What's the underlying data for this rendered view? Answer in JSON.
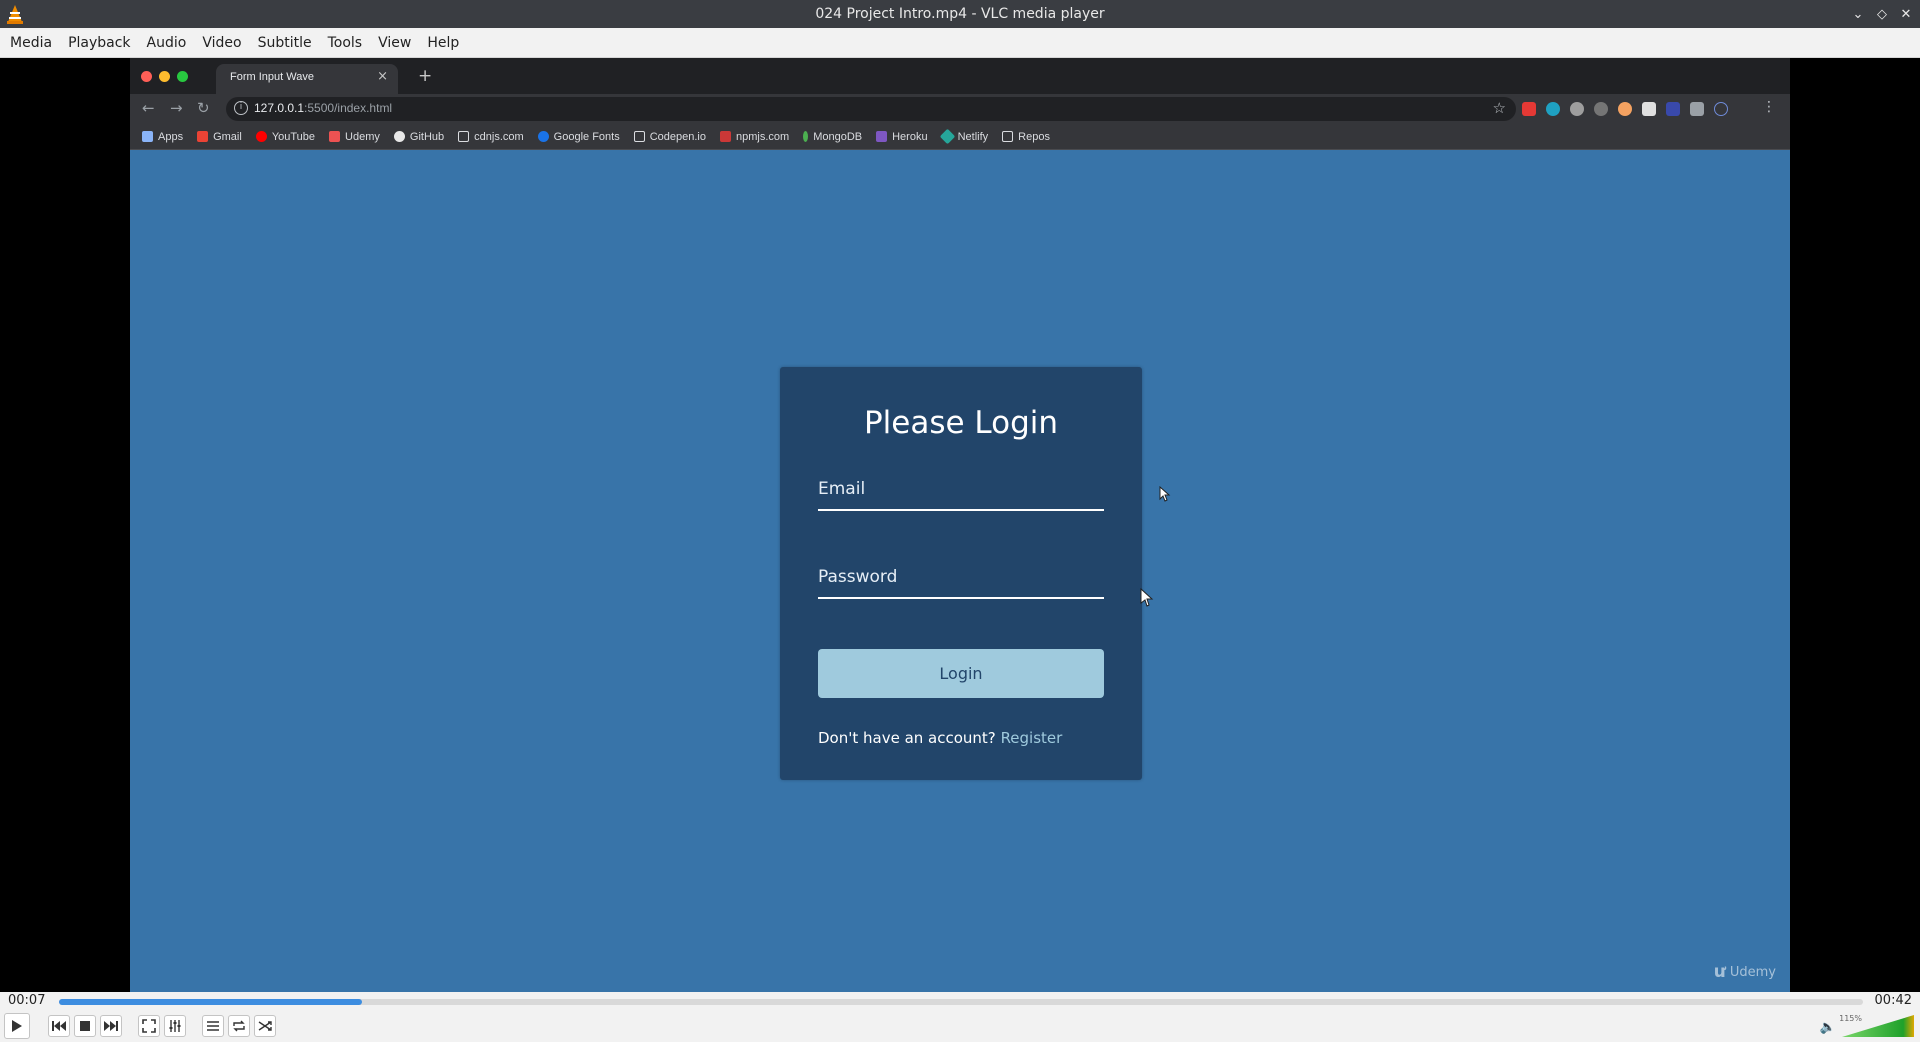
{
  "window": {
    "title": "024 Project Intro.mp4 - VLC media player"
  },
  "menubar": {
    "items": [
      "Media",
      "Playback",
      "Audio",
      "Video",
      "Subtitle",
      "Tools",
      "View",
      "Help"
    ]
  },
  "browser": {
    "tab_title": "Form Input Wave",
    "url_host": "127.0.0.1",
    "url_rest": ":5500/index.html",
    "bookmarks": [
      "Apps",
      "Gmail",
      "YouTube",
      "Udemy",
      "GitHub",
      "cdnjs.com",
      "Google Fonts",
      "Codepen.io",
      "npmjs.com",
      "MongoDB",
      "Heroku",
      "Netlify",
      "Repos"
    ]
  },
  "login": {
    "title": "Please Login",
    "email_label": "Email",
    "password_label": "Password",
    "button_label": "Login",
    "register_prompt": "Don't have an account?",
    "register_link": "Register"
  },
  "watermark": "Udemy",
  "player": {
    "elapsed": "00:07",
    "total": "00:42",
    "progress_fraction": 0.168,
    "volume_label": "115%",
    "volume_fraction": 1.0
  },
  "colors": {
    "page_background": "#3874a9",
    "card_background": "#22456a",
    "button_background": "#9fcadd",
    "seek_fill": "#3d8de0"
  },
  "icons": {
    "controls": [
      "play-icon",
      "previous-icon",
      "stop-icon",
      "next-icon",
      "fullscreen-icon",
      "extended-settings-icon",
      "playlist-icon",
      "loop-icon",
      "shuffle-icon",
      "volume-icon"
    ]
  }
}
